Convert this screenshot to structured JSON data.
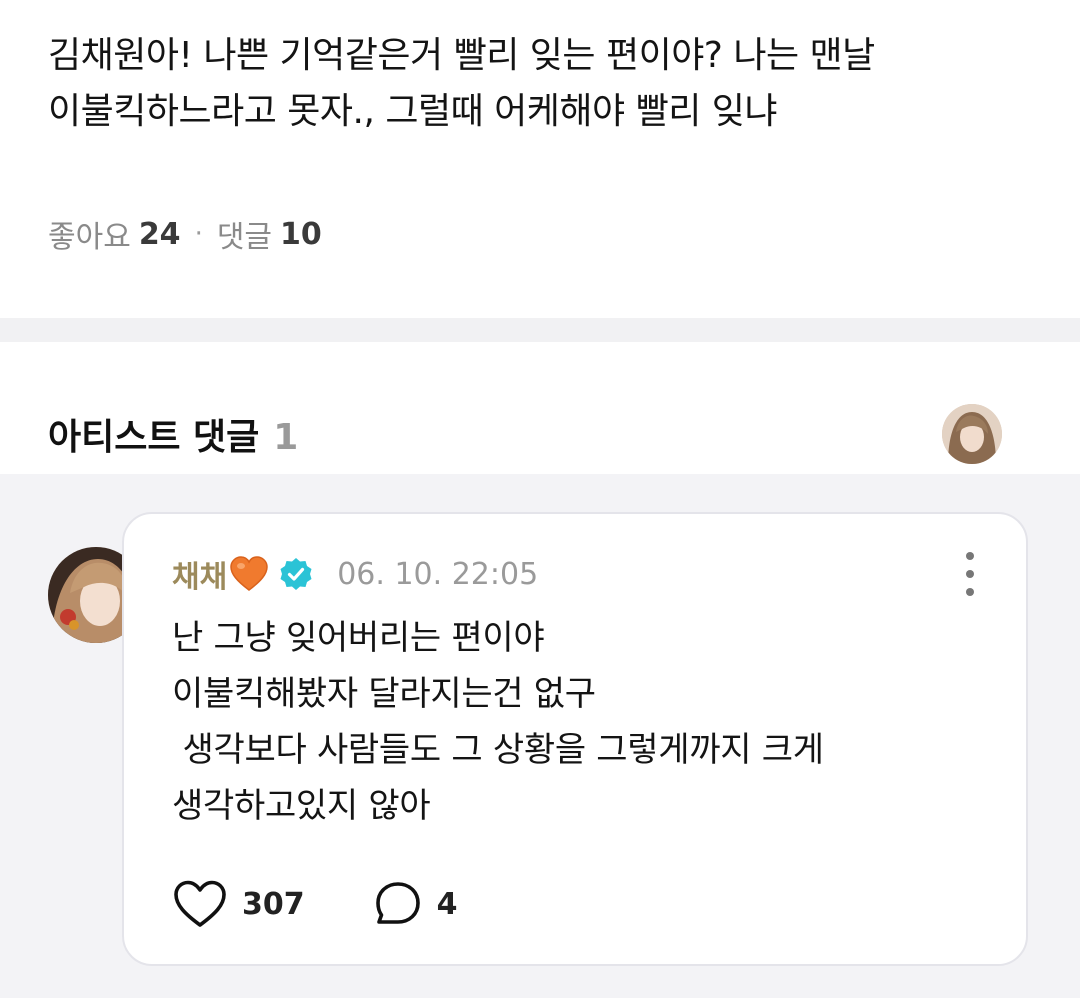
{
  "post": {
    "body": "김채원아! 나쁜 기억같은거 빨리 잊는 편이야? 나는 맨날\n이불킥하느라고 못자., 그럴때 어케해야 빨리 잊냐",
    "likes_label": "좋아요",
    "likes_count": "24",
    "separator": "·",
    "comments_label": "댓글",
    "comments_count": "10"
  },
  "artist_comments": {
    "title": "아티스트 댓글",
    "count": "1"
  },
  "comment": {
    "author": "채채",
    "author_emoji": "orange-heart-icon",
    "verified": "verified-badge-icon",
    "timestamp": "06. 10. 22:05",
    "text": "난 그냥 잊어버리는 편이야\n이불킥해봤자 달라지는건 없구\n 생각보다 사람들도 그 상황을 그렇게까지 크게\n생각하고있지 않아",
    "like_count": "307",
    "reply_count": "4"
  },
  "colors": {
    "author_name": "#9c8a5b",
    "verified_badge": "#2bc3d6",
    "background_band": "#f1f1f3",
    "comments_background": "#f3f3f6"
  }
}
